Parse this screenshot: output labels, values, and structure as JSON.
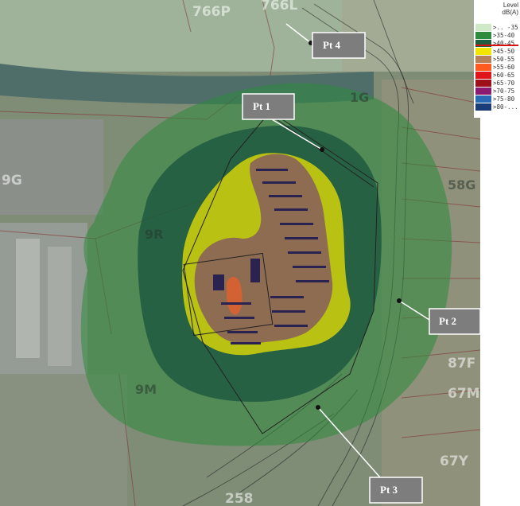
{
  "parcels": [
    "766P",
    "766L",
    "1G",
    "9G",
    "9R",
    "58G",
    "9M",
    "87F",
    "67M",
    "67Y",
    "258"
  ],
  "points": [
    {
      "label": "Pt 1"
    },
    {
      "label": "Pt 2"
    },
    {
      "label": "Pt 3"
    },
    {
      "label": "Pt 4"
    }
  ],
  "legend": {
    "title_line1": "Level",
    "title_line2": "dB(A)",
    "bands": [
      {
        "label": ">.. -35",
        "color": "#cfe8c6"
      },
      {
        "label": ">35-40",
        "color": "#2e8b3d"
      },
      {
        "label": ">40-45",
        "color": "#1f5e3e"
      },
      {
        "label": ">45-50",
        "color": "#f2e600"
      },
      {
        "label": ">50-55",
        "color": "#b6805a"
      },
      {
        "label": ">55-60",
        "color": "#ff5a1f"
      },
      {
        "label": ">60-65",
        "color": "#e0141b"
      },
      {
        "label": ">65-70",
        "color": "#a0101b"
      },
      {
        "label": ">70-75",
        "color": "#8c1a70"
      },
      {
        "label": ">75-80",
        "color": "#2a6ab4"
      },
      {
        "label": ">80-...",
        "color": "#1a3c78"
      }
    ]
  }
}
